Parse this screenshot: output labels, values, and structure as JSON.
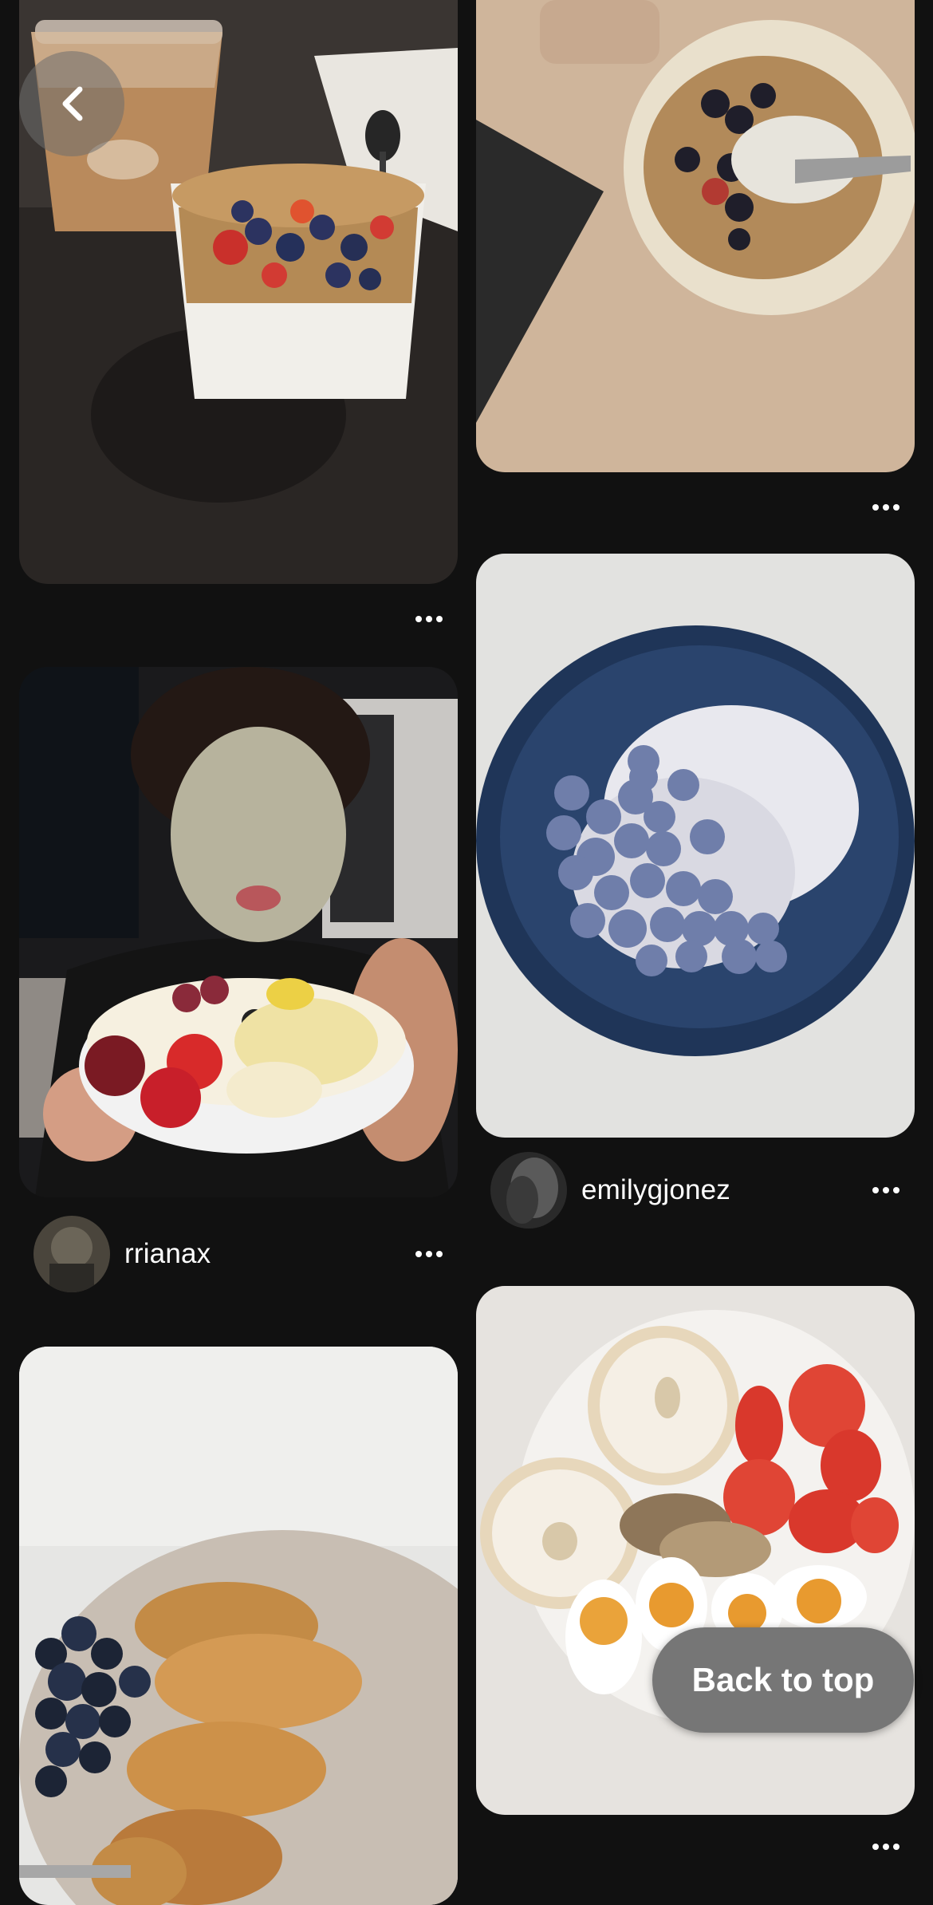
{
  "navigation": {
    "back_icon": "chevron-left-icon"
  },
  "feed": {
    "left_column": [
      {
        "image_description": "Cup of iced coffee beside a yogurt parfait with granola, blueberries and strawberries on a dark table",
        "more_icon": "ellipsis-icon"
      },
      {
        "image_description": "Woman wearing a clay face mask holding a bowl of fruit",
        "creator": "rrianax",
        "more_icon": "ellipsis-icon"
      },
      {
        "image_description": "Plate of pancakes with honey and blueberries on a white fluffy rug"
      }
    ],
    "right_column": [
      {
        "image_description": "Bowl of granola with berries and yogurt next to a laptop on wooden table",
        "more_icon": "ellipsis-icon"
      },
      {
        "image_description": "Navy bowl with chia pudding topped with blueberries",
        "creator": "emilygjonez",
        "more_icon": "ellipsis-icon"
      },
      {
        "image_description": "Plate with bagel halves and cream cheese, strawberries, mixed nuts and soft boiled eggs",
        "more_icon": "ellipsis-icon"
      }
    ]
  },
  "back_to_top": {
    "label": "Back to top"
  },
  "colors": {
    "background": "#111111",
    "button_gray": "#767676",
    "text": "#ffffff"
  }
}
